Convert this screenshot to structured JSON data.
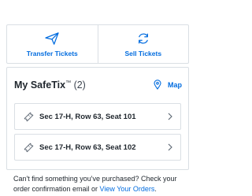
{
  "actions": {
    "transfer": {
      "label": "Transfer Tickets",
      "icon": "paper-plane-icon"
    },
    "sell": {
      "label": "Sell Tickets",
      "icon": "refresh-icon"
    }
  },
  "safetix": {
    "title": "My SafeTix",
    "trademark": "™",
    "count": "(2)",
    "map_label": "Map",
    "map_icon": "map-pin-icon"
  },
  "seats": [
    {
      "label": "Sec 17-H, Row 63, Seat 101"
    },
    {
      "label": "Sec 17-H, Row 63, Seat 102"
    }
  ],
  "footer": {
    "text": "Can't find something you've purchased? Check your order confirmation email or ",
    "link": "View Your Orders",
    "end": "."
  },
  "colors": {
    "accent": "#026cdf",
    "border": "#dadfe4",
    "text": "#1f262d"
  }
}
